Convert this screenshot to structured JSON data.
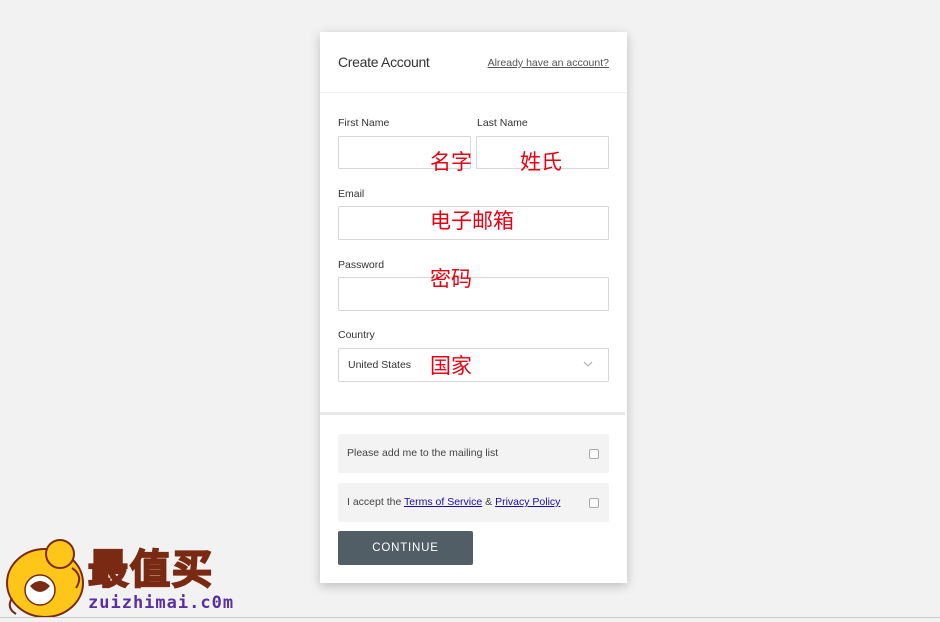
{
  "form": {
    "title": "Create Account",
    "signin_link": "Already have an account?",
    "first_name": {
      "label": "First Name",
      "value": "",
      "annotation": "名字"
    },
    "last_name": {
      "label": "Last Name",
      "value": "",
      "annotation": "姓氏"
    },
    "email": {
      "label": "Email",
      "value": "",
      "annotation": "电子邮箱"
    },
    "password": {
      "label": "Password",
      "value": "",
      "annotation": "密码"
    },
    "country": {
      "label": "Country",
      "selected": "United States",
      "annotation": "国家"
    },
    "mailing_list": {
      "label": "Please add me to the mailing list",
      "checked": false
    },
    "terms": {
      "prefix": "I accept the",
      "terms_link": "Terms of Service",
      "amp": "&",
      "privacy_link": "Privacy Policy",
      "checked": false
    },
    "continue_label": "CONTINUE"
  },
  "watermark": {
    "text": "最值买",
    "url": "zuizhimai.c0m"
  },
  "colors": {
    "page_bg": "#f2f2f2",
    "card_bg": "#ffffff",
    "button_bg": "#525e66",
    "annotation": "#e60012",
    "link": "#1a0dab"
  }
}
